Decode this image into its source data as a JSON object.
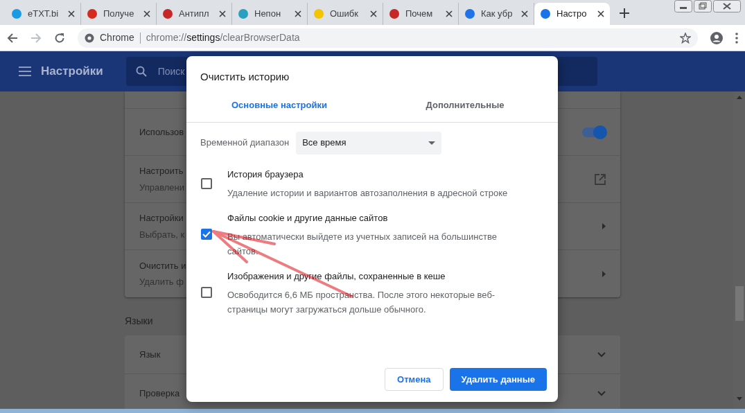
{
  "tabs": [
    {
      "title": "eTXT.bi",
      "selected": false
    },
    {
      "title": "Получе",
      "selected": false
    },
    {
      "title": "Антипл",
      "selected": false
    },
    {
      "title": "Непон",
      "selected": false
    },
    {
      "title": "Ошибк",
      "selected": false
    },
    {
      "title": "Почем",
      "selected": false
    },
    {
      "title": "Как убр",
      "selected": false
    },
    {
      "title": "Настро",
      "selected": true
    }
  ],
  "address_bar": {
    "site_label": "Chrome",
    "url": [
      "chrome://",
      "settings",
      "/clearBrowserData"
    ]
  },
  "settings_header": {
    "title": "Настройки",
    "search_placeholder": "Поиск"
  },
  "settings_rows": [
    {
      "kind": "toggle",
      "title": "Использов",
      "on": true
    },
    {
      "kind": "link",
      "title": "Настроить",
      "subtitle": "Управлени"
    },
    {
      "kind": "arrow",
      "title": "Настройки",
      "subtitle": "Выбрать, к"
    },
    {
      "kind": "arrow",
      "title": "Очистить и",
      "subtitle": "Удалить ф"
    }
  ],
  "languages_section": {
    "heading": "Языки",
    "rows": [
      {
        "title": "Язык"
      },
      {
        "title": "Проверка"
      }
    ]
  },
  "dialog": {
    "title": "Очистить историю",
    "tabs": [
      {
        "label": "Основные настройки",
        "selected": true
      },
      {
        "label": "Дополнительные",
        "selected": false
      }
    ],
    "time_range": {
      "label": "Временной диапазон",
      "value": "Все время"
    },
    "options": [
      {
        "title": "История браузера",
        "description": "Удаление истории и вариантов автозаполнения в адресной строке",
        "checked": false
      },
      {
        "title": "Файлы cookie и другие данные сайтов",
        "description": "Вы автоматически выйдете из учетных записей на большинстве сайтов.",
        "checked": true
      },
      {
        "title": "Изображения и другие файлы, сохраненные в кеше",
        "description": "Освободится 6,6 МБ пространства. После этого некоторые веб-страницы могут загружаться дольше обычного.",
        "checked": false
      }
    ],
    "buttons": [
      {
        "kind": "secondary",
        "label": "Отмена"
      },
      {
        "kind": "primary",
        "label": "Удалить данные"
      }
    ]
  }
}
